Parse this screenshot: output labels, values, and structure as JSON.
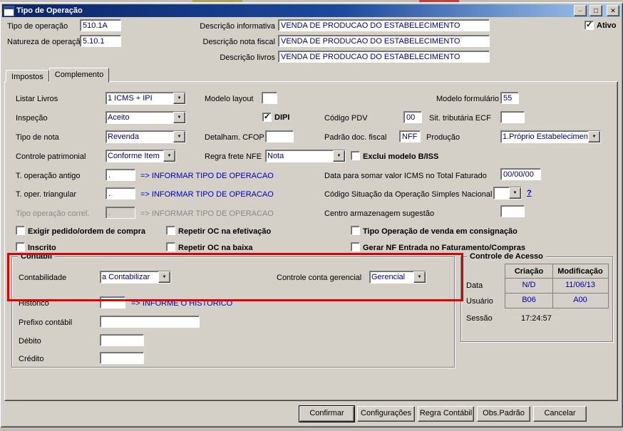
{
  "colors": {
    "titlebar_left": "#0a246a",
    "titlebar_right": "#a6caf0",
    "value_text": "#000080",
    "hint_text": "#0000bb",
    "annotation_red": "#dd0000",
    "chrome_gray": "#d4d0c8"
  },
  "window": {
    "title": "Tipo de Operação"
  },
  "header": {
    "tipo_operacao": {
      "label": "Tipo de operação",
      "value": "510.1A"
    },
    "natureza_operacao": {
      "label": "Natureza de operação",
      "value": "5.10.1"
    },
    "descricao_informativa": {
      "label": "Descrição informativa",
      "value": "VENDA DE PRODUCAO DO ESTABELECIMENTO"
    },
    "descricao_nota_fiscal": {
      "label": "Descrição nota fiscal",
      "value": "VENDA DE PRODUCAO DO ESTABELECIMENTO"
    },
    "descricao_livros": {
      "label": "Descrição livros",
      "value": "VENDA DE PRODUCAO DO ESTABELECIMENTO"
    },
    "ativo": {
      "label": "Ativo",
      "checked": true
    }
  },
  "tabs": {
    "impostos": "Impostos",
    "complemento": "Complemento",
    "active": "Complemento"
  },
  "fields": {
    "listar_livros": {
      "label": "Listar Livros",
      "value": "1 ICMS + IPI"
    },
    "modelo_layout": {
      "label": "Modelo layout",
      "value": ""
    },
    "modelo_formulario": {
      "label": "Modelo formulário",
      "value": "55"
    },
    "inspecao": {
      "label": "Inspeção",
      "value": "Aceito"
    },
    "dipi": {
      "label": "DIPI",
      "checked": true
    },
    "codigo_pdv": {
      "label": "Código PDV",
      "value": "00"
    },
    "sit_tributaria_ecf": {
      "label": "Sit. tributária ECF",
      "value": ""
    },
    "tipo_de_nota": {
      "label": "Tipo de nota",
      "value": "Revenda"
    },
    "detalham_cfop": {
      "label": "Detalham. CFOP",
      "value": ""
    },
    "padrao_doc_fiscal": {
      "label": "Padrão doc. fiscal",
      "value": "NFF"
    },
    "producao": {
      "label": "Produção",
      "value": "1.Próprio Estabelecimen"
    },
    "controle_patrimonial": {
      "label": "Controle patrimonial",
      "value": "Conforme Item"
    },
    "regra_frete_nfe": {
      "label": "Regra frete NFE",
      "value": "Nota"
    },
    "exclui_modelo_biss": {
      "label": "Exclui modelo B/ISS",
      "checked": false
    },
    "t_operacao_antigo": {
      "label": "T. operação antigo",
      "value": ".",
      "hint": "=> INFORMAR TIPO DE OPERACAO"
    },
    "data_somar_icms": {
      "label": "Data para somar valor ICMS no Total Faturado",
      "value": "00/00/00"
    },
    "t_oper_triangular": {
      "label": "T. oper. triangular",
      "value": ".",
      "hint": "=> INFORMAR TIPO DE OPERACAO"
    },
    "cod_situacao_simples": {
      "label": "Código Situação da Operação Simples Nacional",
      "value": "",
      "help": "?"
    },
    "tipo_operacao_correl": {
      "label": "Tipo operação correl.",
      "value": ".",
      "hint": "=> INFORMAR TIPO DE OPERACAO",
      "disabled": true
    },
    "centro_armazenagem": {
      "label": "Centro armazenagem sugestão",
      "value": ""
    }
  },
  "checkboxes": {
    "exigir_pedido": {
      "label": "Exigir pedido/ordem de compra",
      "checked": false
    },
    "repetir_oc_efetivacao": {
      "label": "Repetir OC na efetivação",
      "checked": false
    },
    "tipo_op_venda_consignacao": {
      "label": "Tipo Operação de venda em consignação",
      "checked": false
    },
    "inscrito": {
      "label": "Inscrito",
      "checked": false
    },
    "repetir_oc_baixa": {
      "label": "Repetir OC na baixa",
      "checked": false
    },
    "gerar_nf_entrada": {
      "label": "Gerar NF Entrada no Faturamento/Compras",
      "checked": false
    }
  },
  "contabil": {
    "title": "Contábil",
    "contabilidade": {
      "label": "Contabilidade",
      "value": "a Contabilizar"
    },
    "controle_conta_gerencial": {
      "label": "Controle conta gerencial",
      "value": "Gerencial"
    },
    "historico": {
      "label": "Histórico",
      "value": "",
      "hint": "=> INFORME O HISTORICO"
    },
    "prefixo_contabil": {
      "label": "Prefixo contábil",
      "value": ""
    },
    "debito": {
      "label": "Débito",
      "value": ""
    },
    "credito": {
      "label": "Crédito",
      "value": ""
    }
  },
  "controle_acesso": {
    "title": "Controle de Acesso",
    "col_criacao": "Criação",
    "col_modificacao": "Modificação",
    "rows": {
      "data": {
        "label": "Data",
        "criacao": "N/D",
        "modificacao": "11/06/13"
      },
      "usuario": {
        "label": "Usuário",
        "criacao": "B06",
        "modificacao": "A00"
      },
      "sessao": {
        "label": "Sessão",
        "value": "17:24:57"
      }
    }
  },
  "footer": {
    "buttons": [
      "Confirmar",
      "Configurações",
      "Regra Contábil",
      "Obs.Padrão",
      "Cancelar"
    ]
  }
}
